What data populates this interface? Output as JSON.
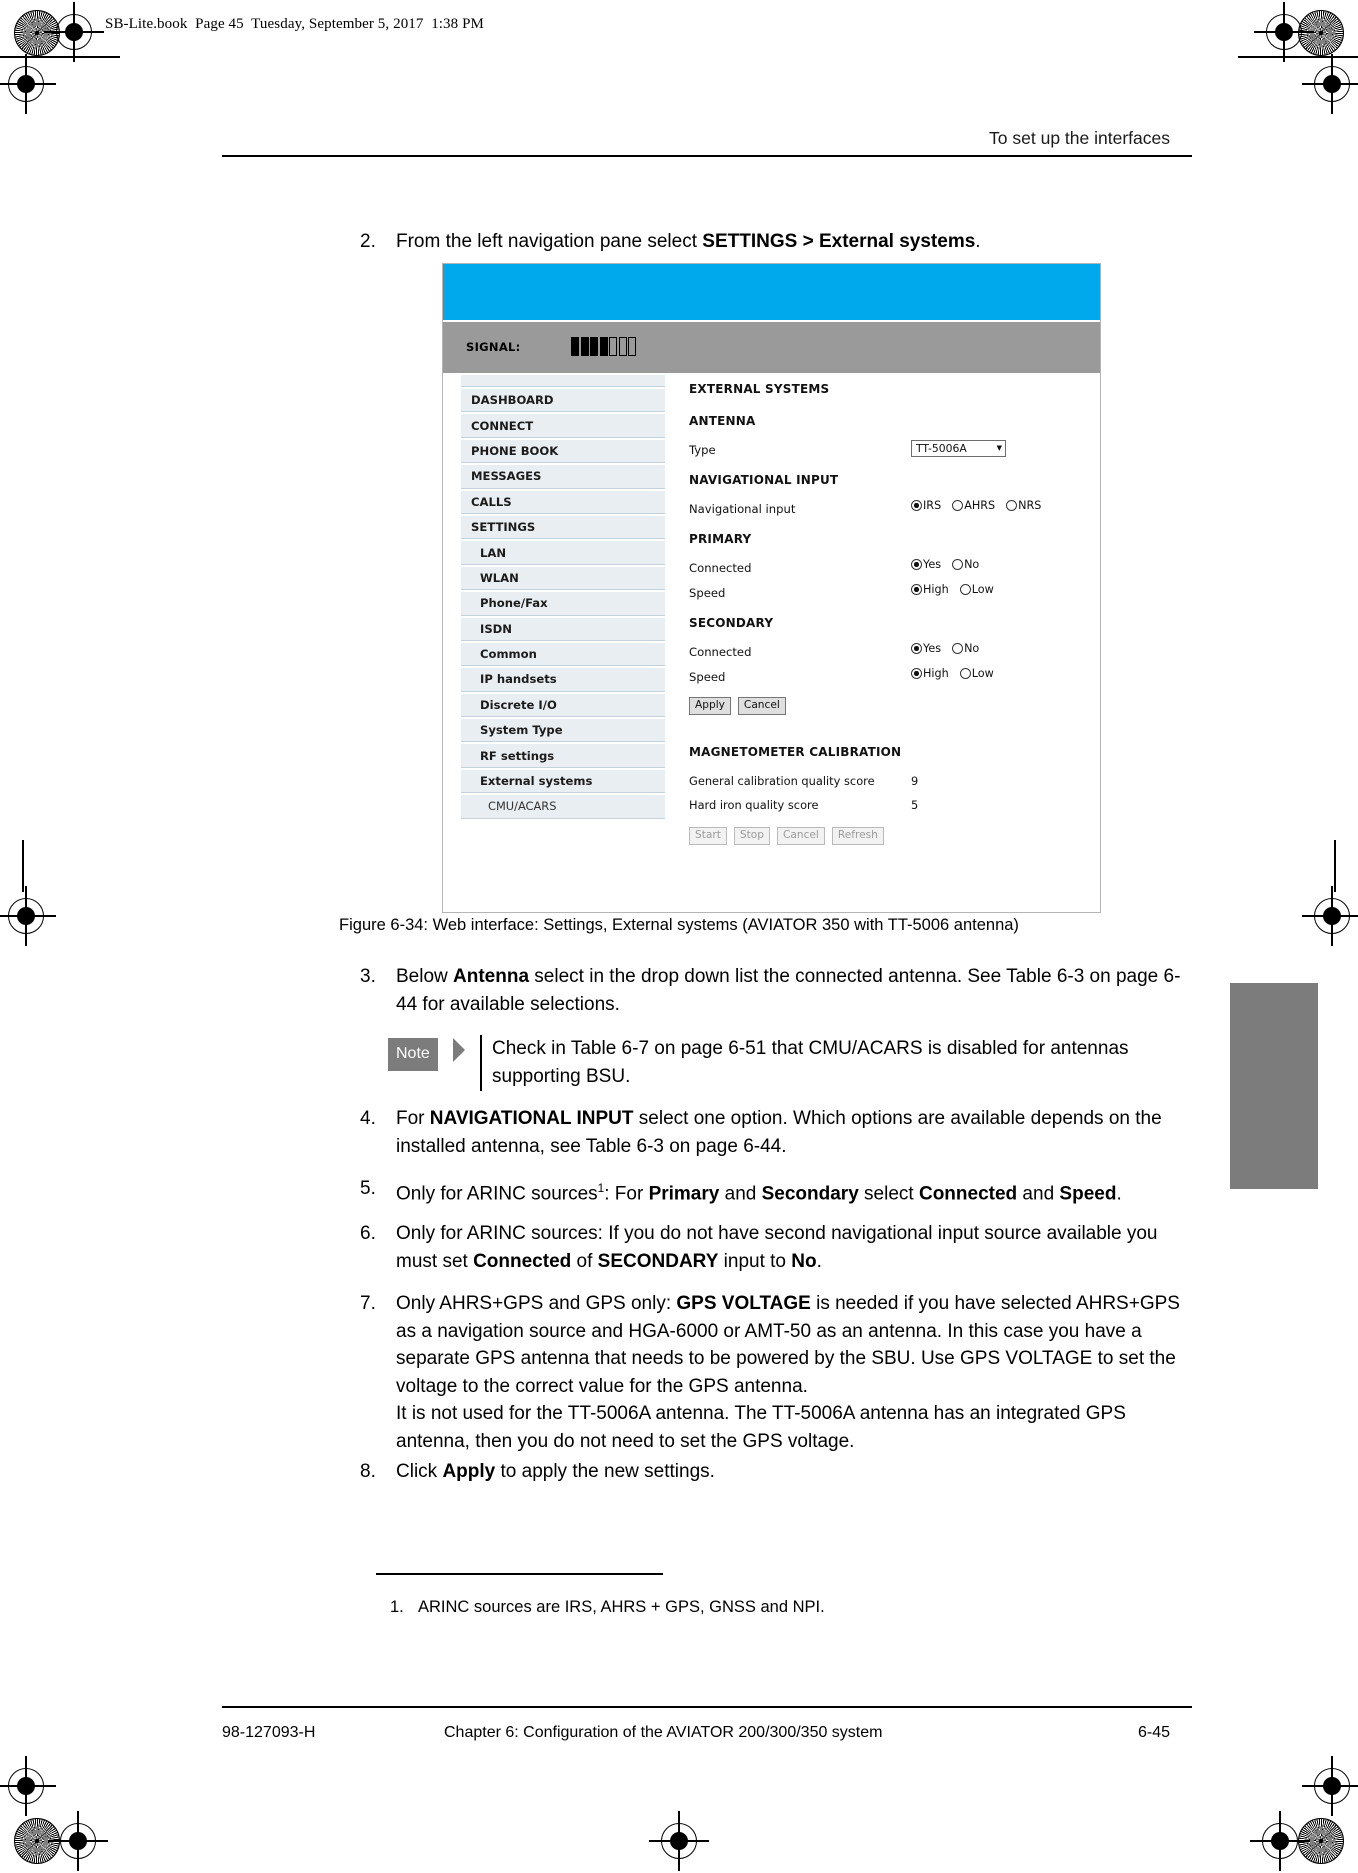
{
  "book_info": "SB-Lite.book  Page 45  Tuesday, September 5, 2017  1:38 PM",
  "header": {
    "running_head": "To set up the interfaces"
  },
  "footer": {
    "doc_number": "98-127093-H",
    "chapter": "Chapter 6:  Configuration of the AVIATOR 200/300/350 system",
    "page_number": "6-45"
  },
  "steps": [
    {
      "num": "2.",
      "html": "From the left navigation pane select <b>SETTINGS &gt; External systems</b>."
    },
    {
      "num": "3.",
      "html": "Below <b>Antenna</b> select in the drop down list the connected antenna. See Table 6-3 on page 6-44 for available selections."
    },
    {
      "num": "4.",
      "html": "For <b>NAVIGATIONAL INPUT</b> select one option. Which options are available depends on the installed antenna, see Table 6-3 on page 6-44."
    },
    {
      "num": "5.",
      "html": "Only for ARINC sources<sup>1</sup>: For <b>Primary</b> and <b>Secondary</b> select <b>Connected</b> and <b>Speed</b>."
    },
    {
      "num": "6.",
      "html": "Only for ARINC sources: If you do not have second navigational input source available you must set <b>Connected</b> of <b>SECONDARY</b> input to <b>No</b>."
    },
    {
      "num": "7.",
      "html": "Only AHRS+GPS and GPS only: <b>GPS VOLTAGE</b> is needed if you have selected AHRS+GPS as a navigation source and HGA-6000 or AMT-50 as an antenna. In this case you have a separate GPS antenna that needs to be powered by the SBU. Use GPS VOLTAGE to set the voltage to the correct value for the GPS antenna.<br>It is not used for the TT-5006A antenna. The TT-5006A antenna has an integrated GPS antenna, then you do not need to set the GPS voltage."
    },
    {
      "num": "8.",
      "html": "Click <b>Apply</b> to apply the new settings."
    }
  ],
  "note": {
    "tag": "Note",
    "text": "Check in Table 6-7 on page 6-51 that CMU/ACARS is disabled for antennas supporting BSU."
  },
  "figure": {
    "caption": "Figure 6-34: Web interface: Settings, External systems (AVIATOR 350 with TT-5006 antenna)"
  },
  "footnote": {
    "num": "1.",
    "text": "ARINC sources are IRS, AHRS + GPS, GNSS and NPI."
  },
  "webui": {
    "banner_color": "#00a8ec",
    "signal": {
      "label": "SIGNAL:",
      "bars_filled": 4,
      "bars_total": 7
    },
    "nav": [
      {
        "label": "DASHBOARD",
        "level": 0
      },
      {
        "label": "CONNECT",
        "level": 0
      },
      {
        "label": "PHONE BOOK",
        "level": 0
      },
      {
        "label": "MESSAGES",
        "level": 0
      },
      {
        "label": "CALLS",
        "level": 0
      },
      {
        "label": "SETTINGS",
        "level": 0
      },
      {
        "label": "LAN",
        "level": 1
      },
      {
        "label": "WLAN",
        "level": 1
      },
      {
        "label": "Phone/Fax",
        "level": 1
      },
      {
        "label": "ISDN",
        "level": 1
      },
      {
        "label": "Common",
        "level": 1
      },
      {
        "label": "IP handsets",
        "level": 1
      },
      {
        "label": "Discrete I/O",
        "level": 1
      },
      {
        "label": "System Type",
        "level": 1
      },
      {
        "label": "RF settings",
        "level": 1
      },
      {
        "label": "External systems",
        "level": 1
      },
      {
        "label": "CMU/ACARS",
        "level": 2
      }
    ],
    "page_title": "EXTERNAL SYSTEMS",
    "antenna": {
      "heading": "ANTENNA",
      "type_label": "Type",
      "type_value": "TT-5006A"
    },
    "navigational_input": {
      "heading": "NAVIGATIONAL INPUT",
      "label": "Navigational input",
      "options": [
        "IRS",
        "AHRS",
        "NRS"
      ],
      "selected": "IRS"
    },
    "primary": {
      "heading": "PRIMARY",
      "connected_label": "Connected",
      "connected_options": [
        "Yes",
        "No"
      ],
      "connected_selected": "Yes",
      "speed_label": "Speed",
      "speed_options": [
        "High",
        "Low"
      ],
      "speed_selected": "High"
    },
    "secondary": {
      "heading": "SECONDARY",
      "connected_label": "Connected",
      "connected_options": [
        "Yes",
        "No"
      ],
      "connected_selected": "Yes",
      "speed_label": "Speed",
      "speed_options": [
        "High",
        "Low"
      ],
      "speed_selected": "High"
    },
    "form_buttons": [
      {
        "label": "Apply",
        "disabled": false
      },
      {
        "label": "Cancel",
        "disabled": false
      }
    ],
    "magnetometer": {
      "heading": "MAGNETOMETER CALIBRATION",
      "rows": [
        {
          "label": "General calibration quality score",
          "value": "9"
        },
        {
          "label": "Hard iron quality score",
          "value": "5"
        }
      ],
      "buttons": [
        {
          "label": "Start",
          "disabled": true
        },
        {
          "label": "Stop",
          "disabled": true
        },
        {
          "label": "Cancel",
          "disabled": true
        },
        {
          "label": "Refresh",
          "disabled": true
        }
      ]
    }
  }
}
